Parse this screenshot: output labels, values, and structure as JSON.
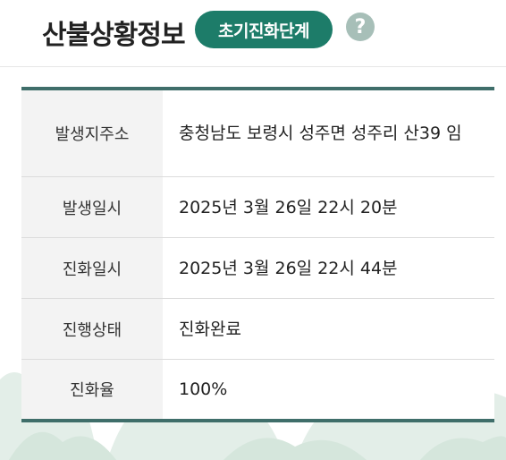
{
  "header": {
    "title": "산불상황정보",
    "stage_badge": "초기진화단계",
    "help_symbol": "?"
  },
  "table": {
    "rows": [
      {
        "label": "발생지주소",
        "value": "충청남도 보령시 성주면 성주리 산39 임"
      },
      {
        "label": "발생일시",
        "value": "2025년 3월 26일 22시 20분"
      },
      {
        "label": "진화일시",
        "value": "2025년 3월 26일 22시 44분"
      },
      {
        "label": "진행상태",
        "value": "진화완료"
      },
      {
        "label": "진화율",
        "value": "100%"
      }
    ]
  },
  "colors": {
    "accent": "#1d7c69",
    "table_border": "#3f6e6a",
    "help_icon": "#a7bfb8"
  },
  "icons": {
    "help": "question-circle-icon"
  }
}
